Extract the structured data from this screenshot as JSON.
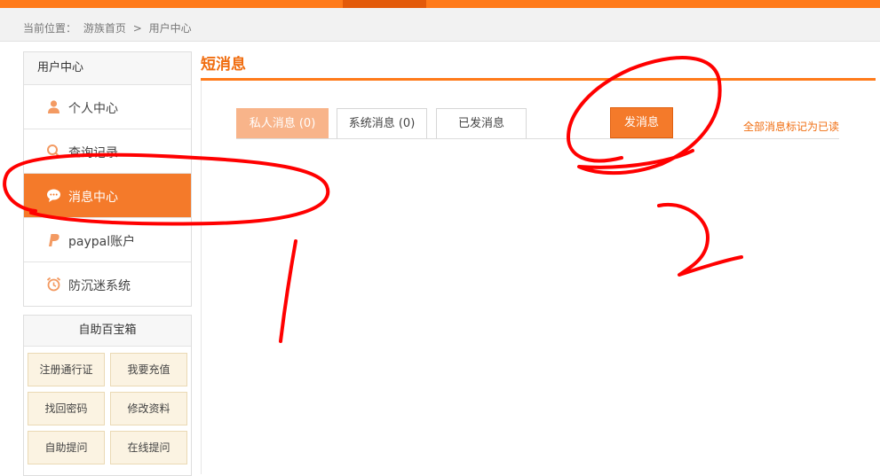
{
  "breadcrumb": {
    "prefix": "当前位置：",
    "home": "游族首页",
    "sep": ">",
    "current": "用户中心"
  },
  "sidebar": {
    "title": "用户中心",
    "items": [
      {
        "label": "个人中心",
        "icon": "user-icon"
      },
      {
        "label": "查询记录",
        "icon": "search-icon"
      },
      {
        "label": "消息中心",
        "icon": "chat-bubble-icon",
        "active": true
      },
      {
        "label": "paypal账户",
        "icon": "paypal-icon"
      },
      {
        "label": "防沉迷系统",
        "icon": "alarm-clock-icon"
      }
    ]
  },
  "toolbox": {
    "title": "自助百宝箱",
    "items": [
      "注册通行证",
      "我要充值",
      "找回密码",
      "修改资料",
      "自助提问",
      "在线提问"
    ]
  },
  "main": {
    "title": "短消息",
    "tabs": [
      {
        "label": "私人消息 (0)",
        "active": true
      },
      {
        "label": "系统消息 (0)"
      },
      {
        "label": "已发消息"
      }
    ],
    "send_button": "发消息",
    "mark_all_read": "全部消息标记为已读"
  },
  "colors": {
    "accent": "#ff7a1a",
    "active_item": "#f47a2a",
    "tab_active": "#f8b48a",
    "annotation": "#ff0000"
  },
  "annotations": {
    "label_1": "1",
    "label_2": "2"
  }
}
